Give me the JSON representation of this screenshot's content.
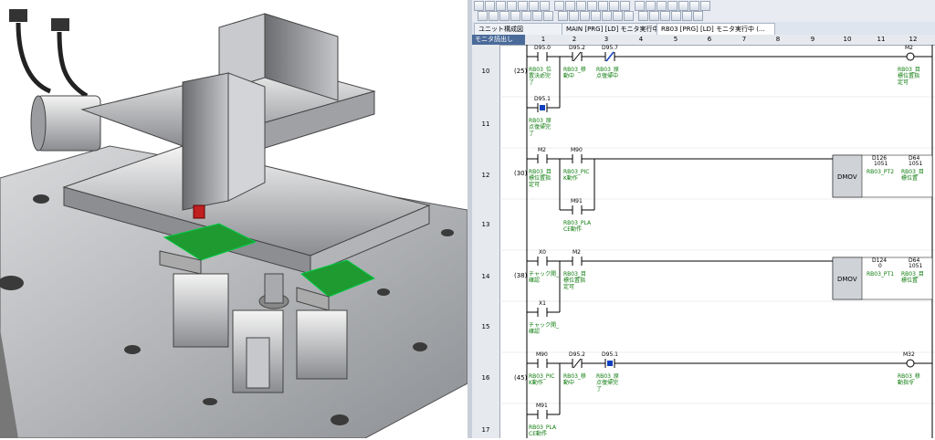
{
  "toolbar": {
    "icons": [
      "new-icon",
      "open-icon",
      "save-icon",
      "print-icon",
      "cut-icon",
      "copy-icon",
      "paste-icon",
      "undo-icon",
      "redo-icon",
      "find-icon",
      "contact-icon",
      "coil-icon",
      "function-icon",
      "compile-icon",
      "monitor-icon",
      "write-icon",
      "read-icon",
      "zoom-icon"
    ]
  },
  "tabs": [
    {
      "label": "ユニット構成図",
      "active": false
    },
    {
      "label": "MAIN [PRG] [LD] モニタ実行中 (...",
      "active": false
    },
    {
      "label": "RB03 [PRG] [LD] モニタ実行中 (...",
      "active": true
    }
  ],
  "column_header": {
    "monitor_label": "モニタ読出し",
    "columns": [
      "1",
      "2",
      "3",
      "4",
      "5",
      "6",
      "7",
      "8",
      "9",
      "10",
      "11",
      "12"
    ]
  },
  "rows": [
    "10",
    "11",
    "12",
    "13",
    "14",
    "15",
    "16",
    "17"
  ],
  "rungs": [
    {
      "step": "(25)",
      "devices": [
        "D95.0",
        "D95.2",
        "D95.7",
        "M2",
        "D95.1"
      ],
      "comments": [
        "RB03_位",
        "置決め完",
        "了",
        "RB03_移",
        "動中",
        "RB03_原",
        "点復帰中",
        "RB03_目",
        "標位置指",
        "定可",
        "RB03_原",
        "点復帰完",
        "了"
      ]
    },
    {
      "step": "(30)",
      "devices": [
        "M2",
        "M90",
        "M91",
        "D126",
        "1051",
        "D64",
        "1051"
      ],
      "instruction": "DMOV",
      "comments": [
        "RB03_目",
        "標位置指",
        "定可",
        "RB03_PIC",
        "K動作",
        "RB03_PLA",
        "CE動作",
        "RB03_PT2",
        "RB03_目",
        "標位置"
      ]
    },
    {
      "step": "(38)",
      "devices": [
        "X0",
        "M2",
        "X1",
        "D124",
        "0",
        "D64",
        "1051"
      ],
      "instruction": "DMOV",
      "comments": [
        "チャック開_",
        "確認",
        "RB03_目",
        "標位置指",
        "定可",
        "RB03_PT1",
        "RB03_目",
        "標位置",
        "チャック開_",
        "確認"
      ]
    },
    {
      "step": "(45)",
      "devices": [
        "M90",
        "D95.2",
        "D95.1",
        "M32",
        "M91"
      ],
      "comments": [
        "RB03_PIC",
        "K動作",
        "RB03_移",
        "動中",
        "RB03_原",
        "点復帰完",
        "了",
        "RB03_移",
        "動指令",
        "RB03_PLA",
        "CE動作"
      ]
    }
  ],
  "colors": {
    "comment_green": "#0a7a0a",
    "monitor_on": "#1040c0",
    "instruction_box": "#cfd3d8",
    "window_bg": "#e8ecf2"
  }
}
